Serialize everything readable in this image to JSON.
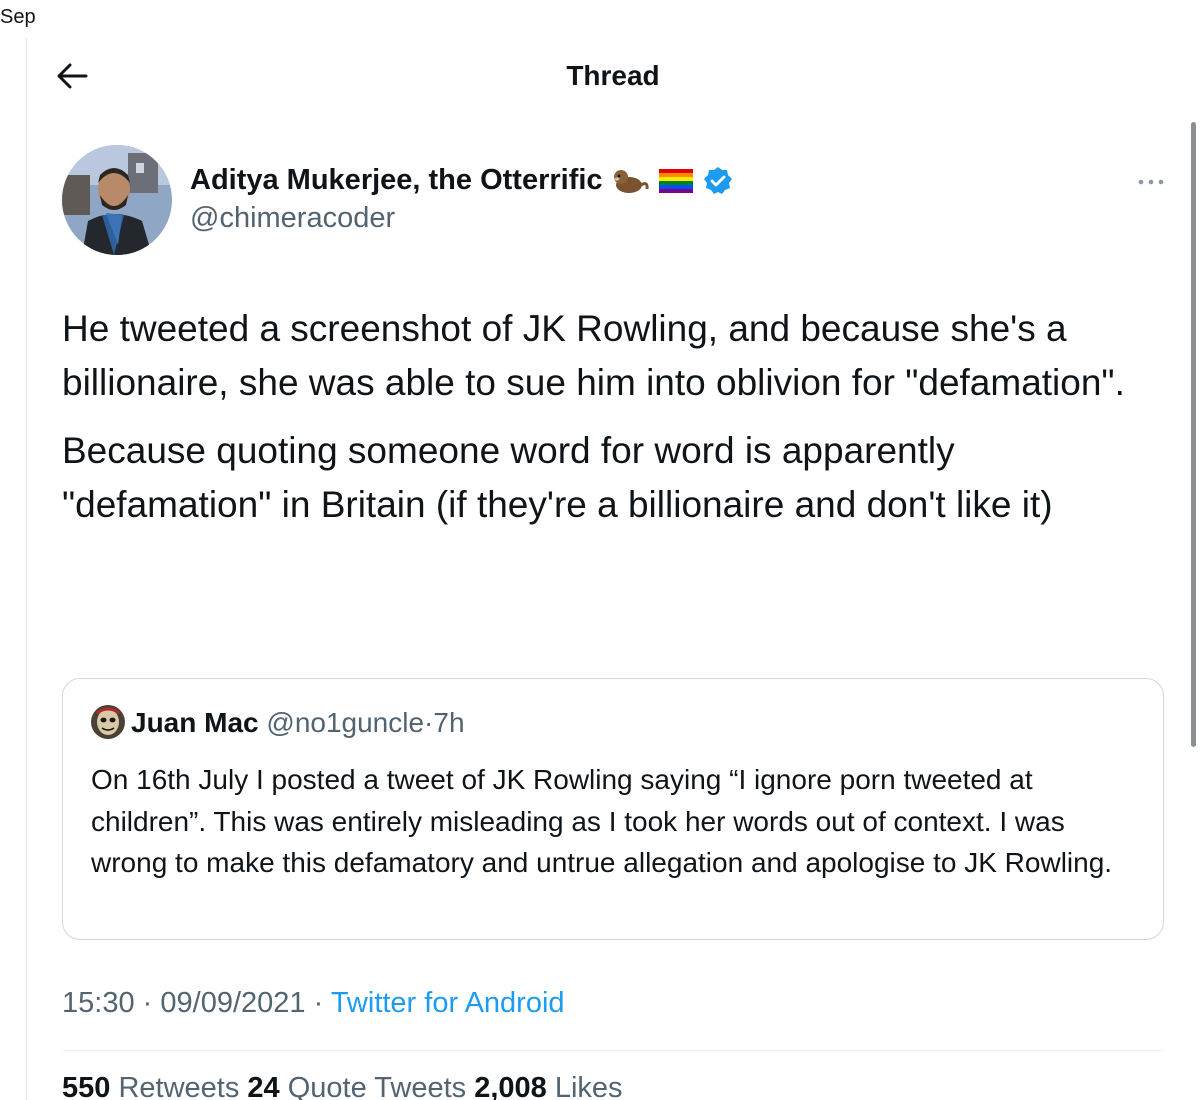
{
  "corner_date": "Sep",
  "header": {
    "title": "Thread",
    "back_icon": "arrow-left-icon"
  },
  "tweet": {
    "author_name": "Aditya Mukerjee, the Otterrific",
    "author_handle": "@chimeracoder",
    "name_icons": [
      "otter-emoji-icon",
      "rainbow-flag-emoji-icon",
      "verified-badge-icon"
    ],
    "text_paragraphs": [
      "He tweeted a screenshot of JK Rowling, and because she's a billionaire, she was able to sue him into oblivion for \"defamation\".",
      "Because quoting someone word for word is apparently \"defamation\" in Britain (if they're a billionaire and don't like it)"
    ],
    "more_icon": "more-dots-icon"
  },
  "quoted_tweet": {
    "name": "Juan Mac",
    "handle": "@no1guncle",
    "separator": "·",
    "time": "7h",
    "text": "On 16th July I posted a tweet of JK Rowling saying “I ignore porn tweeted at children”. This was entirely misleading as I took her words out of context. I was wrong to make this defamatory and untrue allegation and apologise to JK Rowling."
  },
  "meta": {
    "time": "15:30",
    "separator": "·",
    "date": "09/09/2021",
    "source": "Twitter for Android"
  },
  "stats": {
    "retweets_count": "550",
    "retweets_label": "Retweets",
    "quotes_count": "24",
    "quotes_label": "Quote Tweets",
    "likes_count": "2,008",
    "likes_label": "Likes"
  },
  "colors": {
    "accent": "#1d9bf0",
    "text": "#0f1419",
    "secondary_text": "#536471",
    "border": "#cfd9de"
  }
}
